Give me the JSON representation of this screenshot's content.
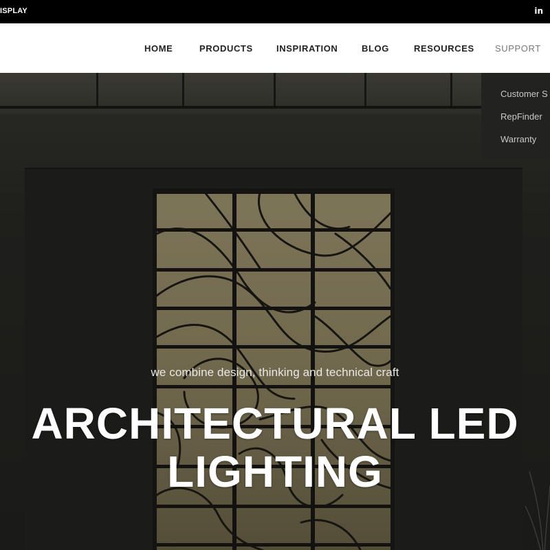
{
  "topbar": {
    "left_text": "ISPLAY",
    "social_icon": "linkedin-icon",
    "social_label": "in"
  },
  "nav": {
    "items": [
      {
        "label": "HOME"
      },
      {
        "label": "PRODUCTS"
      },
      {
        "label": "INSPIRATION"
      },
      {
        "label": "BLOG"
      },
      {
        "label": "RESOURCES"
      },
      {
        "label": "SUPPORT",
        "active": true
      }
    ]
  },
  "dropdown": {
    "items": [
      {
        "label": "Customer S"
      },
      {
        "label": "RepFinder"
      },
      {
        "label": "Warranty"
      }
    ]
  },
  "hero": {
    "tagline": "we combine design, thinking and technical craft",
    "headline_line1": "ARCHITECTURAL LED",
    "headline_line2": "LIGHTING"
  },
  "colors": {
    "topbar_bg": "#000000",
    "nav_bg": "#ffffff",
    "nav_text": "#222222",
    "nav_active": "#777777",
    "dropdown_bg": "#222221",
    "panel_glow": "#8a8060"
  }
}
